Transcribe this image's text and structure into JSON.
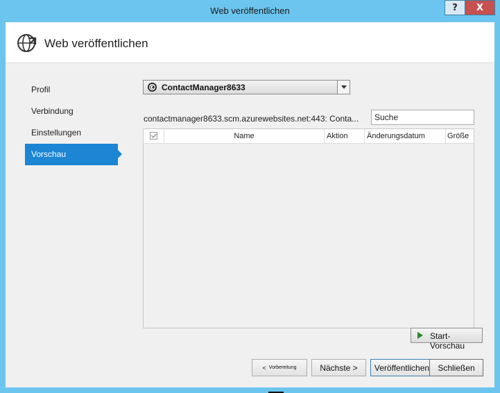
{
  "window": {
    "title": "Web veröffentlichen",
    "help_label": "?",
    "close_label": "X"
  },
  "header": {
    "title": "Web veröffentlichen"
  },
  "nav": {
    "items": [
      {
        "label": "Profil"
      },
      {
        "label": "Verbindung"
      },
      {
        "label": "Einstellungen"
      },
      {
        "label": "Vorschau",
        "active": true
      }
    ]
  },
  "profile": {
    "selected": "ContactManager8633"
  },
  "connection": {
    "text": "contactmanager8633.scm.azurewebsites.net:443: Conta..."
  },
  "search": {
    "value": "Suche"
  },
  "table": {
    "columns": {
      "name": "Name",
      "aktion": "Aktion",
      "datum": "Änderungsdatum",
      "groesse": "Größe"
    }
  },
  "preview": {
    "start_label": "Start-Vorschau"
  },
  "buttons": {
    "prev_arrow": "<",
    "prev": "Vorbereitung",
    "next": "Nächste >",
    "publish": "Veröffentlichen",
    "close": "Schließen"
  },
  "colors": {
    "accent": "#1c85d4",
    "titlebar": "#6cc5ee",
    "close": "#c75050",
    "play": "#2a8a2a"
  }
}
